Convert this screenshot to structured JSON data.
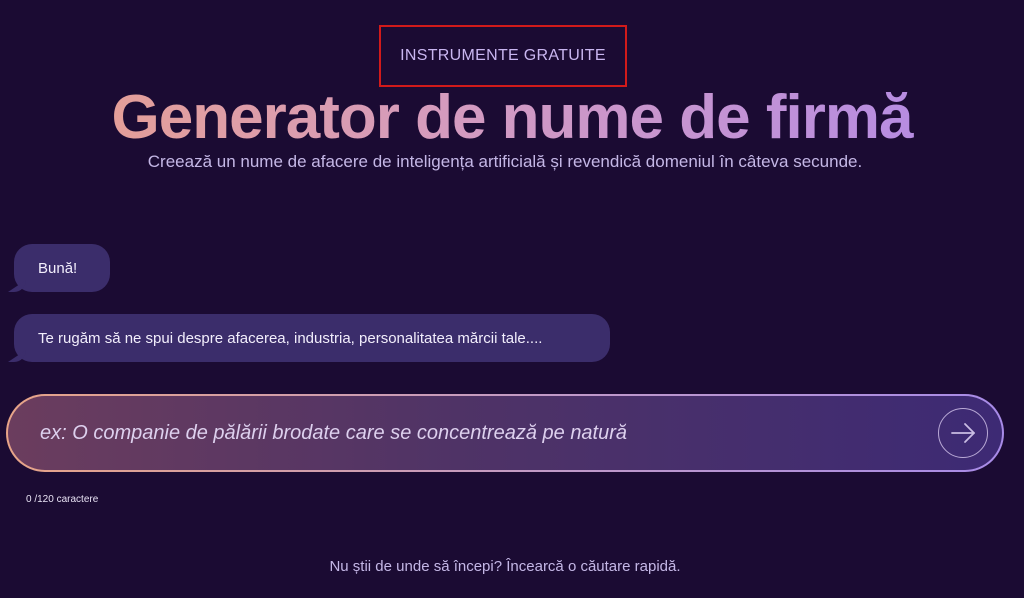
{
  "header": {
    "eyebrow": "INSTRUMENTE GRATUITE",
    "title": "Generator de nume de firmă",
    "subtitle": "Creează un nume de afacere de inteligența artificială și revendică domeniul în câteva secunde."
  },
  "chat": {
    "messages": [
      {
        "text": "Bună!"
      },
      {
        "text": "Te rugăm să ne spui despre afacerea, industria, personalitatea mărcii tale...."
      }
    ]
  },
  "input": {
    "placeholder": "ex: O companie de pălării brodate care se concentrează pe natură",
    "value": "",
    "counter": "0 /120 caractere",
    "send_icon": "arrow-right-icon"
  },
  "hint": {
    "text": "Nu știi de unde să începi? Încearcă o căutare rapidă."
  },
  "colors": {
    "background": "#1b0b33",
    "bubble": "#3b2d6b",
    "highlight_box": "#d21a1a",
    "title_gradient_start": "#e9a08d",
    "title_gradient_end": "#b089ea"
  }
}
